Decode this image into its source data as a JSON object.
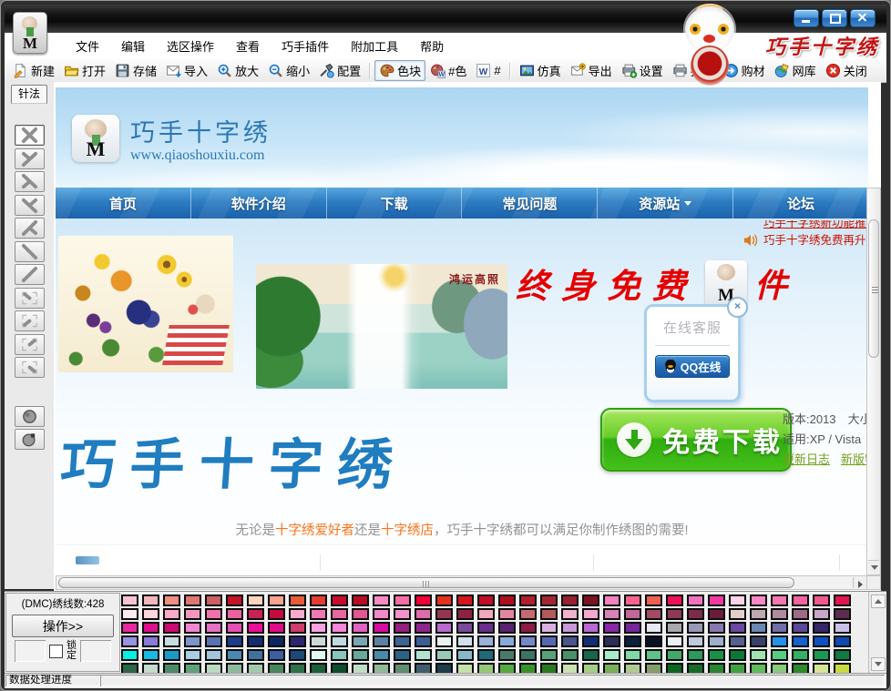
{
  "window": {
    "brand": "巧手十字绣",
    "controls": {
      "minimize": "最小化",
      "maximize": "最大化",
      "close": "关闭"
    }
  },
  "menubar": {
    "items": [
      {
        "name": "file",
        "label": "文件"
      },
      {
        "name": "edit",
        "label": "编辑"
      },
      {
        "name": "selection",
        "label": "选区操作"
      },
      {
        "name": "view",
        "label": "查看"
      },
      {
        "name": "plugins",
        "label": "巧手插件"
      },
      {
        "name": "extra-tools",
        "label": "附加工具"
      },
      {
        "name": "help",
        "label": "帮助"
      }
    ]
  },
  "toolbar": {
    "items": [
      {
        "name": "new",
        "label": "新建",
        "icon": "new-doc"
      },
      {
        "name": "open",
        "label": "打开",
        "icon": "open-folder"
      },
      {
        "name": "save",
        "label": "存储",
        "icon": "save"
      },
      {
        "name": "import",
        "label": "导入",
        "icon": "import"
      },
      {
        "name": "zoom-in",
        "label": "放大",
        "icon": "zoom-in"
      },
      {
        "name": "zoom-out",
        "label": "缩小",
        "icon": "zoom-out"
      },
      {
        "name": "config",
        "label": "配置",
        "icon": "config",
        "sep_after": true
      },
      {
        "name": "color-block",
        "label": "色块",
        "icon": "palette",
        "pressed": true
      },
      {
        "name": "hash-color",
        "label": "#色",
        "icon": "palette-w"
      },
      {
        "name": "w-hash",
        "label": "#",
        "icon": "w-badge",
        "sep_after": true
      },
      {
        "name": "simulate",
        "label": "仿真",
        "icon": "photo"
      },
      {
        "name": "export",
        "label": "导出",
        "icon": "export"
      },
      {
        "name": "settings",
        "label": "设置",
        "icon": "settings"
      },
      {
        "name": "print",
        "label": "打印",
        "icon": "print"
      },
      {
        "name": "buy-material",
        "label": "购材",
        "icon": "buy"
      },
      {
        "name": "web-library",
        "label": "网库",
        "icon": "web"
      },
      {
        "name": "close",
        "label": "关闭",
        "icon": "close-red"
      }
    ]
  },
  "sidebar": {
    "tab_label": "针法",
    "tools": [
      {
        "name": "full-stitch",
        "icon": "st-full",
        "selected": true
      },
      {
        "name": "three-quarter-stitch-1",
        "icon": "st-tq1"
      },
      {
        "name": "three-quarter-stitch-2",
        "icon": "st-tq2"
      },
      {
        "name": "three-quarter-stitch-3",
        "icon": "st-tq3"
      },
      {
        "name": "three-quarter-stitch-4",
        "icon": "st-tq4"
      },
      {
        "name": "half-stitch-back",
        "icon": "st-half1"
      },
      {
        "name": "half-stitch-forward",
        "icon": "st-half2"
      },
      {
        "name": "quarter-stitch-1",
        "icon": "st-q1"
      },
      {
        "name": "quarter-stitch-2",
        "icon": "st-q2"
      },
      {
        "name": "quarter-stitch-3",
        "icon": "st-q3"
      },
      {
        "name": "quarter-stitch-4",
        "icon": "st-q4"
      },
      {
        "name": "french-knot",
        "icon": "st-knot",
        "round_group": true
      },
      {
        "name": "bead",
        "icon": "st-bead"
      }
    ]
  },
  "website": {
    "logo_title": "巧手十字绣",
    "logo_url": "www.qiaoshouxiu.com",
    "nav": [
      {
        "name": "home",
        "label": "首页"
      },
      {
        "name": "software-intro",
        "label": "软件介绍"
      },
      {
        "name": "download",
        "label": "下载"
      },
      {
        "name": "faq",
        "label": "常见问题"
      },
      {
        "name": "resources",
        "label": "资源站",
        "dropdown": true
      },
      {
        "name": "forum",
        "label": "论坛"
      }
    ],
    "marquee": [
      "巧手十字绣新功能推出",
      "巧手十字绣免费再升级"
    ],
    "waterfall_caption": "鸿运高照",
    "banner_free": "终身免费",
    "banner_suffix": "件",
    "qq": {
      "title": "在线客服",
      "button": "QQ在线",
      "close": "×"
    },
    "download": {
      "button_label": "免费下载",
      "version": "版本:2013",
      "size": "大小",
      "os": "适用:XP / Vista",
      "link1": "更新日志",
      "link2": "新版特性"
    },
    "big_title": "巧手十字绣",
    "tagline": {
      "p1": "无论是",
      "hl1": "十字绣爱好者",
      "p2": "还是",
      "hl2": "十字绣店",
      "p3": "，巧手十字绣都可以满足你制作绣图的需要!"
    }
  },
  "bottom": {
    "dmc_label": "(DMC)绣线数:428",
    "action_button": "操作>>",
    "lock_label": "锁定",
    "status_label": "数据处理进度",
    "palette_rows": [
      [
        "#f6c3d5",
        "#f2b6bc",
        "#ee8f82",
        "#e07672",
        "#cb5f62",
        "#c11426",
        "#fdd5bd",
        "#f9a28c",
        "#e75b36",
        "#e43c30",
        "#c70d2e",
        "#b90c22",
        "#f78ac6",
        "#f76ea7",
        "#f20038",
        "#e6311c",
        "#d2161c",
        "#c10c24",
        "#b00c20",
        "#b31e2e",
        "#a32733",
        "#992031",
        "#7c1222",
        "#f580c1",
        "#f9648f",
        "#ee6050",
        "#ee1158",
        "#ef74bf",
        "#f03aa0",
        "#fbd4ea",
        "#f788c5",
        "#f675b3",
        "#f2639f",
        "#f15890",
        "#e01552"
      ],
      [
        "#fdeaf0",
        "#fbd8dd",
        "#f8abca",
        "#f697c0",
        "#f072aa",
        "#ec62a0",
        "#cb2256",
        "#c20c3e",
        "#f8abcf",
        "#ee78b1",
        "#e768a1",
        "#e25691",
        "#ee8ac5",
        "#ef93ca",
        "#de6caa",
        "#963552",
        "#8e2242",
        "#f1aabc",
        "#e187a0",
        "#c26a6e",
        "#b45a5a",
        "#f0b2cc",
        "#f4a8d0",
        "#d883b8",
        "#c06898",
        "#a24c64",
        "#8c3a56",
        "#7c2c48",
        "#6c1c38",
        "#e0d0c8",
        "#c0a8b0",
        "#b08ca0",
        "#9c6c88",
        "#c8a8c8",
        "#5c2c50"
      ],
      [
        "#ea289e",
        "#dc108c",
        "#cc0c70",
        "#ef88d0",
        "#e670c1",
        "#e551b3",
        "#ea1097",
        "#e00c86",
        "#cc3c6c",
        "#f9a2e1",
        "#f886d9",
        "#e062c1",
        "#d60ca1",
        "#93207c",
        "#8d258a",
        "#b96acd",
        "#7b4a99",
        "#6a2d8d",
        "#5c2070",
        "#8c1c44",
        "#d8b0e0",
        "#c898d8",
        "#b868d0",
        "#8828a8",
        "#742898",
        "#e8e8f4",
        "#a8a8ac",
        "#9898b8",
        "#8878b0",
        "#6c48a0",
        "#6888b0",
        "#7070a8",
        "#5c4898",
        "#342868",
        "#c8c0e8"
      ],
      [
        "#9b90e1",
        "#887ad9",
        "#c9dde1",
        "#7d95c9",
        "#5871b1",
        "#1d3d89",
        "#152d6d",
        "#0d2561",
        "#2d2571",
        "#cdd9d9",
        "#c1d9e1",
        "#7da5b1",
        "#5d81a1",
        "#3d6591",
        "#3d5d95",
        "#e9f1f1",
        "#d1e1ed",
        "#9ab1d9",
        "#89a9d9",
        "#7189c9",
        "#5569b1",
        "#49558d",
        "#112d75",
        "#2d2d55",
        "#0d1d3d",
        "#081221",
        "#e9eff5",
        "#c1c9dd",
        "#9db1cd",
        "#55618d",
        "#394169",
        "#2591e9",
        "#1561cd",
        "#0d51c1",
        "#0d49b1"
      ],
      [
        "#00f1e1",
        "#19b9e1",
        "#199bc9",
        "#a9cde1",
        "#a1c5d9",
        "#4989b1",
        "#41719d",
        "#3d5da1",
        "#1d4979",
        "#e1f9f1",
        "#89c5bd",
        "#69a999",
        "#4989a9",
        "#2d6185",
        "#b1e1d1",
        "#99c9b9",
        "#89b9c9",
        "#216979",
        "#497969",
        "#3d7161",
        "#59a179",
        "#499169",
        "#196549",
        "#a9e9c9",
        "#81d9a9",
        "#61c189",
        "#41a969",
        "#2d9959",
        "#199149",
        "#097939",
        "#a1e1b1",
        "#59cd81",
        "#31b161",
        "#199951",
        "#117941"
      ],
      [
        "#2d6549",
        "#c5d9cd",
        "#4d8969",
        "#61a179",
        "#b9d9c1",
        "#8db99d",
        "#a1c9ad",
        "#49855d",
        "#2d7149",
        "#1d5d39",
        "#0d4d2d",
        "#c1ddc5",
        "#91b999",
        "#618d71",
        "#415d6d",
        "#1d3d49",
        "#c5e1a9",
        "#95c979",
        "#55a941",
        "#399129",
        "#297921",
        "#c9e1b1",
        "#a5cd85",
        "#79ad59",
        "#b1c991",
        "#859d69",
        "#0d6521",
        "#196929",
        "#298531",
        "#41a141",
        "#61b959",
        "#89c979",
        "#2d8929",
        "#d5e595",
        "#c9d941"
      ]
    ]
  },
  "colors": {
    "nav_blue": "#2a7bc0",
    "brand_red": "#c41414",
    "download_green": "#3cb519",
    "link_green": "#70a01a",
    "highlight_orange": "#f7741a",
    "site_blue": "#2b77b3"
  }
}
